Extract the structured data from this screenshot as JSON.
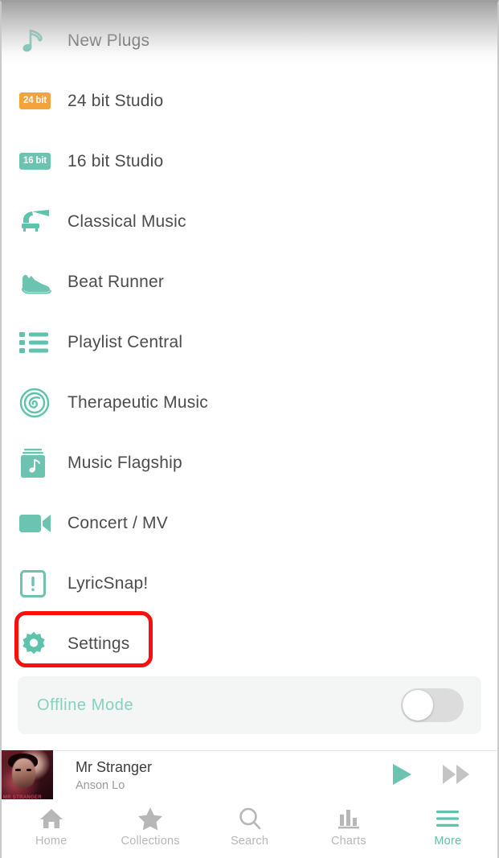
{
  "theme": {
    "accent": "#5ec2ac",
    "accent_light": "#85d0bf",
    "badge_24bit_bg": "#f2a33c",
    "badge_16bit_bg": "#6cc3b0",
    "highlight_annotation": "#fa0f0f",
    "text_primary": "#4c4c4c",
    "text_muted": "#9b9b9b",
    "tab_inactive": "#b7b7b7",
    "panel_bg": "#f4f5f5",
    "toggle_track_off": "#dcdcdc"
  },
  "menu": {
    "items": [
      {
        "label": "New Plugs",
        "icon": "music-note-icon"
      },
      {
        "label": "24 bit Studio",
        "icon": "badge-24bit-icon",
        "badge_text": "24 bit"
      },
      {
        "label": "16 bit Studio",
        "icon": "badge-16bit-icon",
        "badge_text": "16 bit"
      },
      {
        "label": "Classical Music",
        "icon": "gramophone-icon"
      },
      {
        "label": "Beat Runner",
        "icon": "sneaker-icon"
      },
      {
        "label": "Playlist Central",
        "icon": "list-icon"
      },
      {
        "label": "Therapeutic Music",
        "icon": "spiral-icon"
      },
      {
        "label": "Music Flagship",
        "icon": "album-stack-icon"
      },
      {
        "label": "Concert / MV",
        "icon": "video-camera-icon"
      },
      {
        "label": "LyricSnap!",
        "icon": "exclamation-square-icon"
      },
      {
        "label": "Settings",
        "icon": "gear-icon",
        "highlighted": true
      }
    ]
  },
  "offline": {
    "label": "Offline  Mode",
    "toggle_state": "off"
  },
  "now_playing": {
    "title": "Mr Stranger",
    "artist": "Anson Lo",
    "album_art_caption": "MR STRANGER",
    "play_label": "play-button",
    "next_label": "next-button"
  },
  "tabbar": {
    "tabs": [
      {
        "label": "Home",
        "icon": "home-icon",
        "active": false
      },
      {
        "label": "Collections",
        "icon": "star-icon",
        "active": false
      },
      {
        "label": "Search",
        "icon": "search-icon",
        "active": false
      },
      {
        "label": "Charts",
        "icon": "bar-chart-icon",
        "active": false
      },
      {
        "label": "More",
        "icon": "hamburger-icon",
        "active": true
      }
    ]
  }
}
